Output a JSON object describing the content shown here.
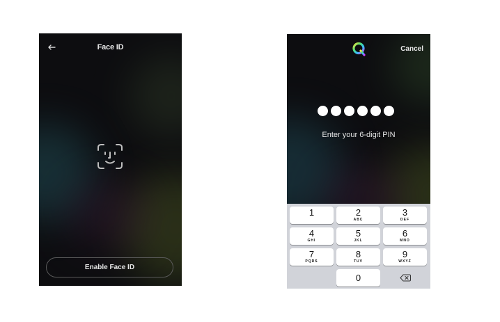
{
  "faceid_screen": {
    "title": "Face ID",
    "back_icon": "arrow-left-icon",
    "face_icon": "face-id-icon",
    "enable_button_label": "Enable Face ID"
  },
  "pin_screen": {
    "logo_icon": "q-logo-icon",
    "cancel_label": "Cancel",
    "pin_digits_entered": 6,
    "pin_prompt": "Enter your 6-digit PIN",
    "keys": [
      {
        "num": "1",
        "letters": ""
      },
      {
        "num": "2",
        "letters": "ABC"
      },
      {
        "num": "3",
        "letters": "DEF"
      },
      {
        "num": "4",
        "letters": "GHI"
      },
      {
        "num": "5",
        "letters": "JKL"
      },
      {
        "num": "6",
        "letters": "MNO"
      },
      {
        "num": "7",
        "letters": "PQRS"
      },
      {
        "num": "8",
        "letters": "TUV"
      },
      {
        "num": "9",
        "letters": "WXYZ"
      },
      {
        "num": "0",
        "letters": ""
      }
    ],
    "delete_icon": "backspace-icon"
  }
}
